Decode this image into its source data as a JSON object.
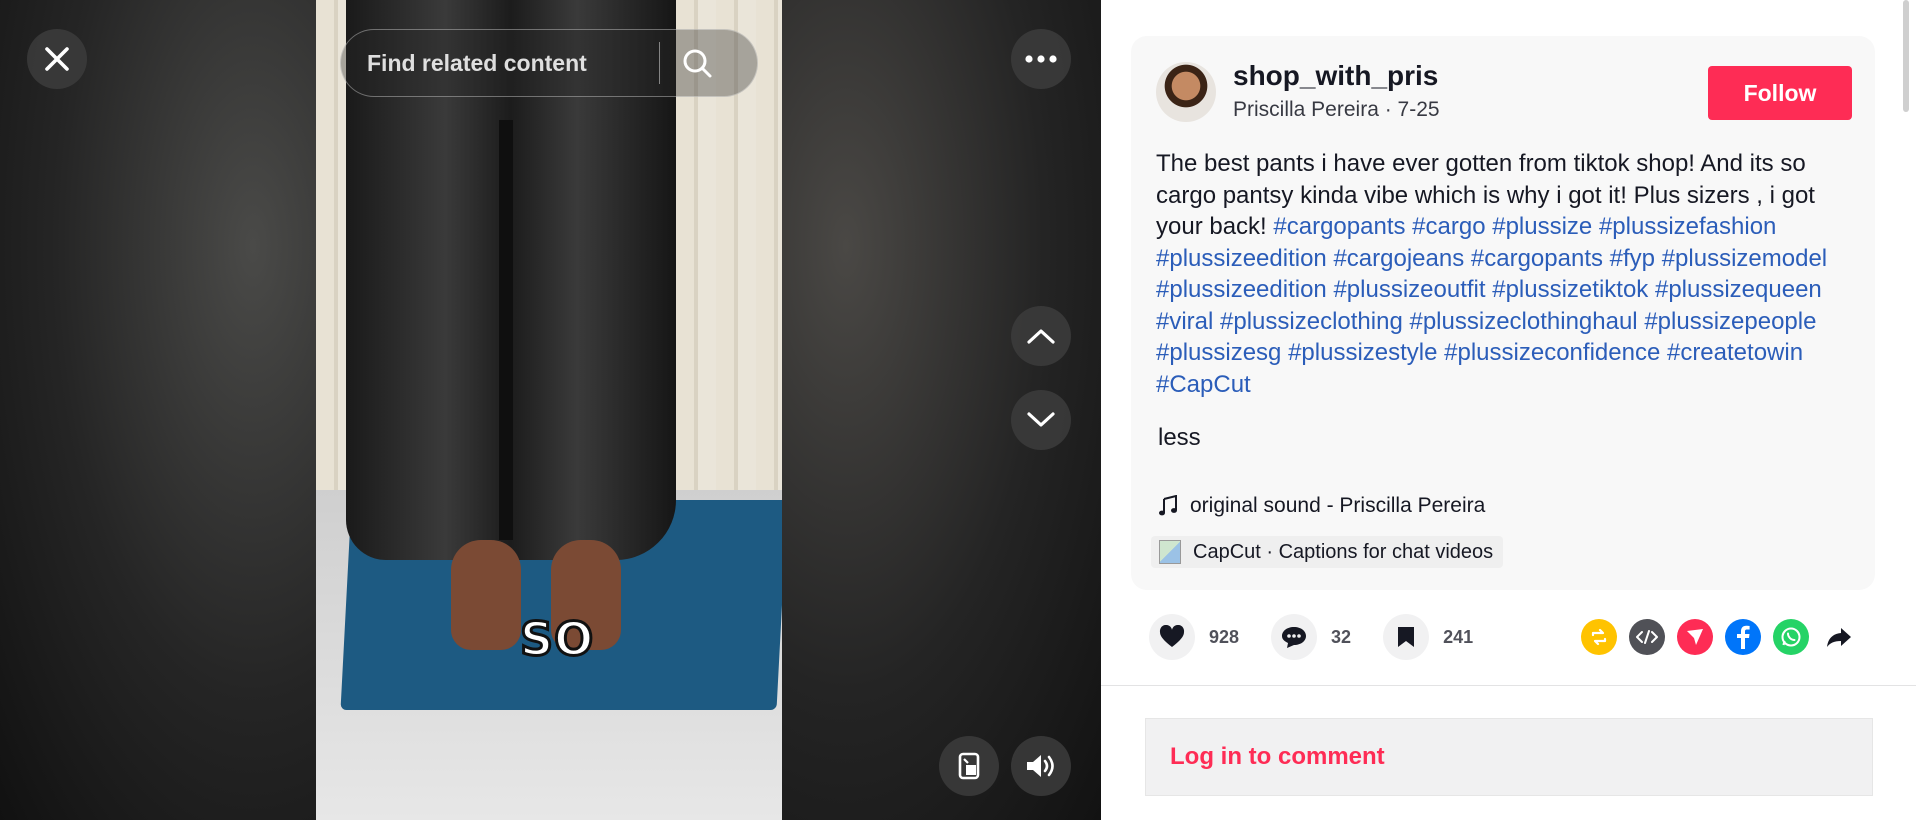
{
  "search": {
    "placeholder": "Find related content"
  },
  "video": {
    "caption_overlay": "SO"
  },
  "author": {
    "username": "shop_with_pris",
    "display_name": "Priscilla Pereira",
    "date": "7-25",
    "follow_label": "Follow"
  },
  "description": {
    "text": "The best pants i have ever gotten from tiktok shop! And its so cargo pantsy kinda vibe which is why i got it! Plus sizers , i got your back! ",
    "hashtags": [
      "#cargopants",
      "#cargo",
      "#plussize",
      "#plussizefashion",
      "#plussizeedition",
      "#cargojeans",
      "#cargopants",
      "#fyp",
      "#plussizemodel",
      "#plussizeedition",
      "#plussizeoutfit",
      "#plussizetiktok",
      "#plussizequeen",
      "#viral",
      "#plussizeclothing",
      "#plussizeclothinghaul",
      "#plussizepeople",
      "#plussizesg",
      "#plussizestyle",
      "#plussizeconfidence",
      "#createtowin",
      "#CapCut"
    ],
    "less_label": "less"
  },
  "music": {
    "label": "original sound - Priscilla Pereira"
  },
  "capcut": {
    "label": "CapCut · Captions for chat videos"
  },
  "stats": {
    "likes": "928",
    "comments": "32",
    "saves": "241"
  },
  "comment": {
    "login_label": "Log in to comment"
  },
  "colors": {
    "accent": "#fe2c55",
    "hashtag": "#2b5db9",
    "repost": "#ffc300",
    "embed": "#505157",
    "send": "#fe2c55",
    "facebook": "#0075fa",
    "whatsapp": "#25d366"
  },
  "icons": [
    "close-icon",
    "search-icon",
    "more-icon",
    "chevron-up-icon",
    "chevron-down-icon",
    "floating-player-icon",
    "volume-icon",
    "music-note-icon",
    "heart-icon",
    "comment-icon",
    "bookmark-icon",
    "repost-icon",
    "embed-icon",
    "send-icon",
    "facebook-icon",
    "whatsapp-icon",
    "share-arrow-icon"
  ]
}
